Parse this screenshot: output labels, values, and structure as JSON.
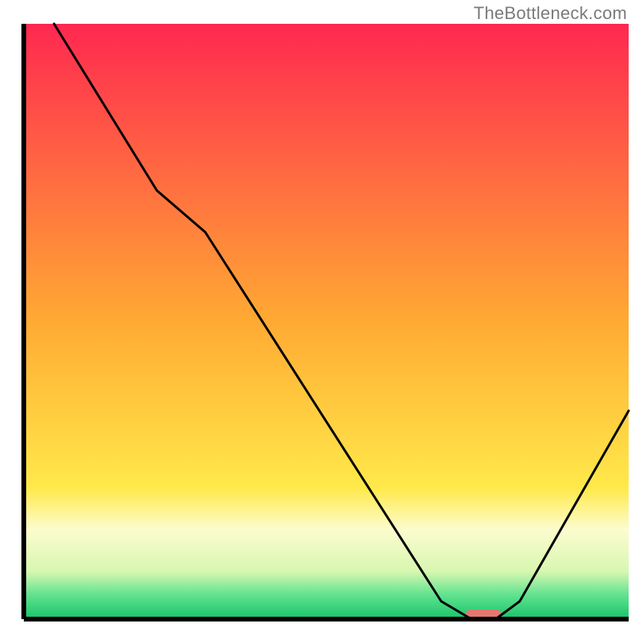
{
  "watermark": "TheBottleneck.com",
  "chart_data": {
    "type": "line",
    "title": "",
    "xlabel": "",
    "ylabel": "",
    "xlim": [
      0,
      100
    ],
    "ylim": [
      0,
      100
    ],
    "grid": false,
    "legend": false,
    "background_gradient": {
      "stops": [
        {
          "offset": 0.0,
          "color": "#ff2850"
        },
        {
          "offset": 0.5,
          "color": "#ffaa33"
        },
        {
          "offset": 0.78,
          "color": "#ffe94a"
        },
        {
          "offset": 0.85,
          "color": "#fcfccf"
        },
        {
          "offset": 0.92,
          "color": "#d7f7b0"
        },
        {
          "offset": 0.96,
          "color": "#5fe28f"
        },
        {
          "offset": 1.0,
          "color": "#17c36a"
        }
      ]
    },
    "series": [
      {
        "name": "bottleneck-curve",
        "color": "#000000",
        "x": [
          5,
          22,
          30,
          69,
          74,
          78,
          82,
          100
        ],
        "values": [
          100,
          72,
          65,
          3,
          0,
          0,
          3,
          35
        ]
      }
    ],
    "markers": [
      {
        "name": "optimal-marker",
        "type": "bar",
        "x_center": 76,
        "x_width": 6,
        "y": 0,
        "color": "#e2776f"
      }
    ]
  }
}
